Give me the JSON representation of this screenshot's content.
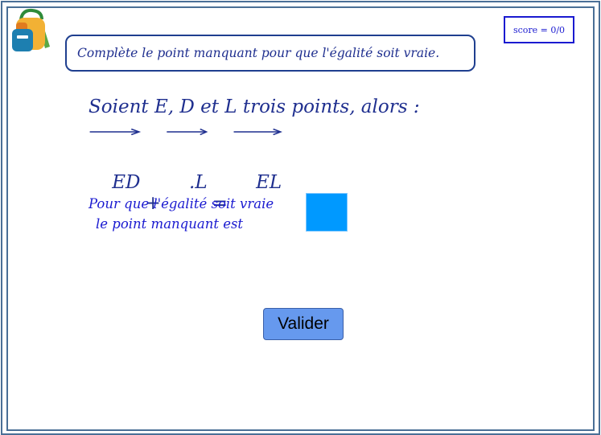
{
  "app": {
    "logo_icon": "backpack-icon"
  },
  "score": {
    "label": "score = 0/0"
  },
  "instruction": {
    "text": "Complète le point manquant pour que l'égalité soit vraie."
  },
  "exercise": {
    "statement": "Soient E,  D et L trois points,  alors :",
    "equation": {
      "term1": "ED",
      "plus": "+",
      "term2": ".L",
      "equals": "=",
      "term3": "EL"
    },
    "prompt_line1": "Pour que l'égalité soit vraie",
    "prompt_line2": "le point manquant est",
    "answer_box": {
      "color": "#0099ff",
      "value": ""
    }
  },
  "actions": {
    "validate_label": "Valider"
  },
  "colors": {
    "frame": "#4a6f96",
    "text": "#1f2f8f",
    "accent": "#1a1ad0",
    "button": "#6699ee"
  }
}
